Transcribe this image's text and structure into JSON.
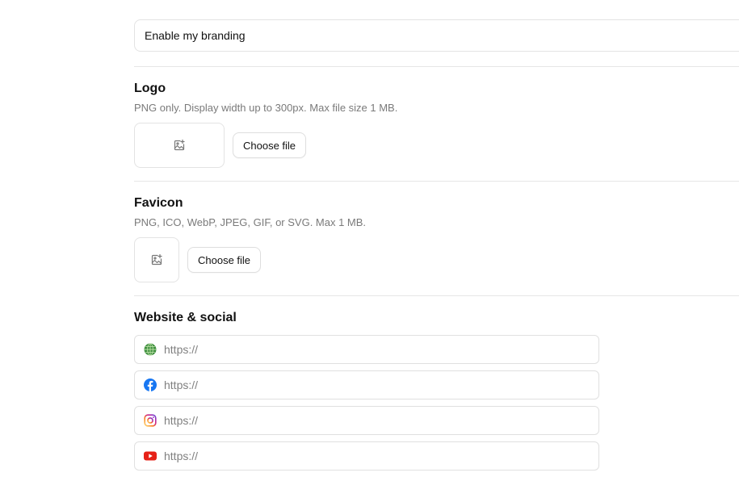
{
  "branding": {
    "toggle_label": "Enable my branding"
  },
  "logo": {
    "title": "Logo",
    "description": "PNG only. Display width up to 300px. Max file size 1 MB.",
    "button_label": "Choose file"
  },
  "favicon": {
    "title": "Favicon",
    "description": "PNG, ICO, WebP, JPEG, GIF, or SVG. Max 1 MB.",
    "button_label": "Choose file"
  },
  "website_social": {
    "title": "Website & social",
    "fields": [
      {
        "icon": "globe-icon",
        "placeholder": "https://",
        "value": ""
      },
      {
        "icon": "facebook-icon",
        "placeholder": "https://",
        "value": ""
      },
      {
        "icon": "instagram-icon",
        "placeholder": "https://",
        "value": ""
      },
      {
        "icon": "youtube-icon",
        "placeholder": "https://",
        "value": ""
      }
    ]
  },
  "colors": {
    "globe": "#3f8f3f",
    "facebook": "#1877f2",
    "instagram": "#d62976",
    "youtube": "#e62117"
  }
}
